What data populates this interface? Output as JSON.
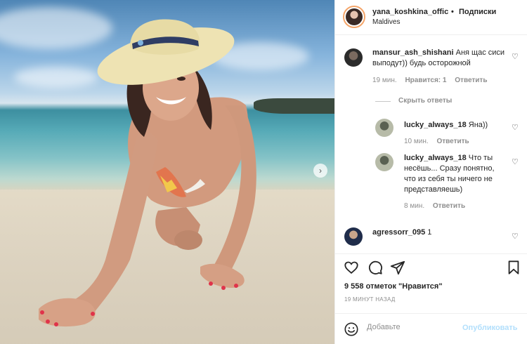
{
  "post": {
    "username": "yana_koshkina_offic",
    "separator": "•",
    "follow_label": "Подписки",
    "location": "Maldives"
  },
  "comments": [
    {
      "user": "mansur_ash_shishani",
      "text": "Аня щас сиси выподут)) будь осторожной",
      "time": "19 мин.",
      "likes": "Нравится: 1",
      "reply_label": "Ответить"
    },
    {
      "user": "lucky_always_18",
      "text": "Яна))",
      "time": "10 мин.",
      "reply_label": "Ответить"
    },
    {
      "user": "lucky_always_18",
      "text": "Что ты несёшь... Сразу понятно, что из себя ты ничего не представляешь)",
      "time": "8 мин.",
      "reply_label": "Ответить"
    },
    {
      "user": "agressorr_095",
      "text": "1"
    }
  ],
  "hide_replies_label": "Скрыть ответы",
  "likes_text": "9 558 отметок \"Нравится\"",
  "time_ago": "19 МИНУТ НАЗАД",
  "add_comment": {
    "placeholder": "Добавьте",
    "post_label": "Опубликовать"
  },
  "icons": {
    "like": "heart-icon",
    "comment": "comment-icon",
    "share": "share-icon",
    "save": "bookmark-icon",
    "emoji": "emoji-icon",
    "next": "chevron-right-icon"
  },
  "colors": {
    "accent_disabled": "#b2dffc",
    "muted": "#8e8e8e"
  }
}
